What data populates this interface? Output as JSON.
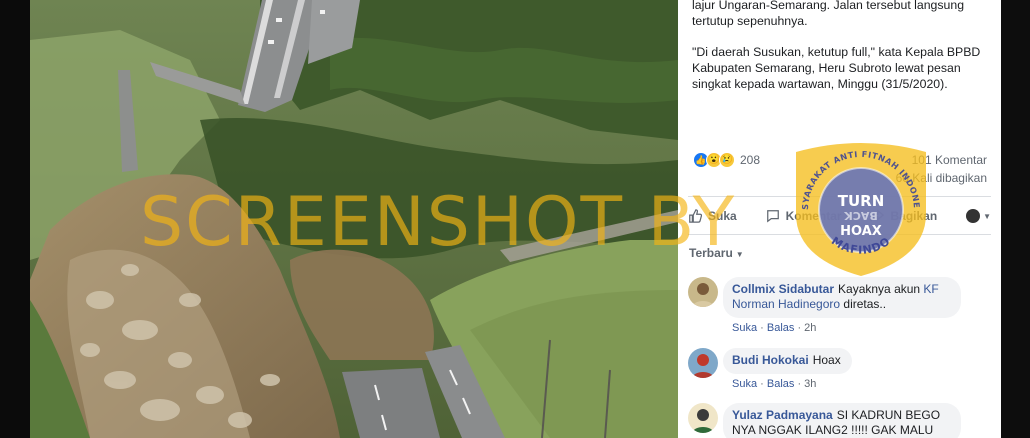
{
  "post": {
    "paragraph_1": "lajur Ungaran-Semarang. Jalan tersebut langsung tertutup sepenuhnya.",
    "paragraph_2": "\"Di daerah Susukan, ketutup full,\" kata Kepala BPBD Kabupaten Semarang, Heru Subroto lewat pesan singkat kepada wartawan, Minggu (31/5/2020)."
  },
  "stats": {
    "reaction_count": "208",
    "comments": "101 Komentar",
    "shares": "60 Kali dibagikan",
    "reaction_icons": [
      "like-icon",
      "wow-icon",
      "sad-icon"
    ]
  },
  "actions": {
    "like": "Suka",
    "comment": "Komentar",
    "share": "Bagikan"
  },
  "sort": {
    "label": "Terbaru"
  },
  "comments": [
    {
      "author": "Collmix Sidabutar",
      "text": "Kayaknya akun ",
      "mention": "KF Norman Hadinegoro",
      "text_after": " diretas..",
      "like": "Suka",
      "reply": "Balas",
      "time": "2h"
    },
    {
      "author": "Budi Hokokai",
      "text": "Hoax",
      "like": "Suka",
      "reply": "Balas",
      "time": "3h"
    },
    {
      "author": "Yulaz Padmayana",
      "text": "SI KADRUN BEGO NYA NGGAK ILANG2 !!!!! GAK MALU"
    }
  ],
  "watermark": {
    "text": "SCREENSHOT BY",
    "seal_top": "TURN",
    "seal_mid": "BACK",
    "seal_bottom": "HOAX",
    "seal_arc": "MASYARAKAT ANTI FITNAH INDONESIA",
    "seal_name": "MAFINDO",
    "color": "#f5b414"
  },
  "colors": {
    "link": "#385898",
    "meta": "#606770",
    "like_blue": "#1877f2",
    "bubble": "#f2f3f5"
  }
}
